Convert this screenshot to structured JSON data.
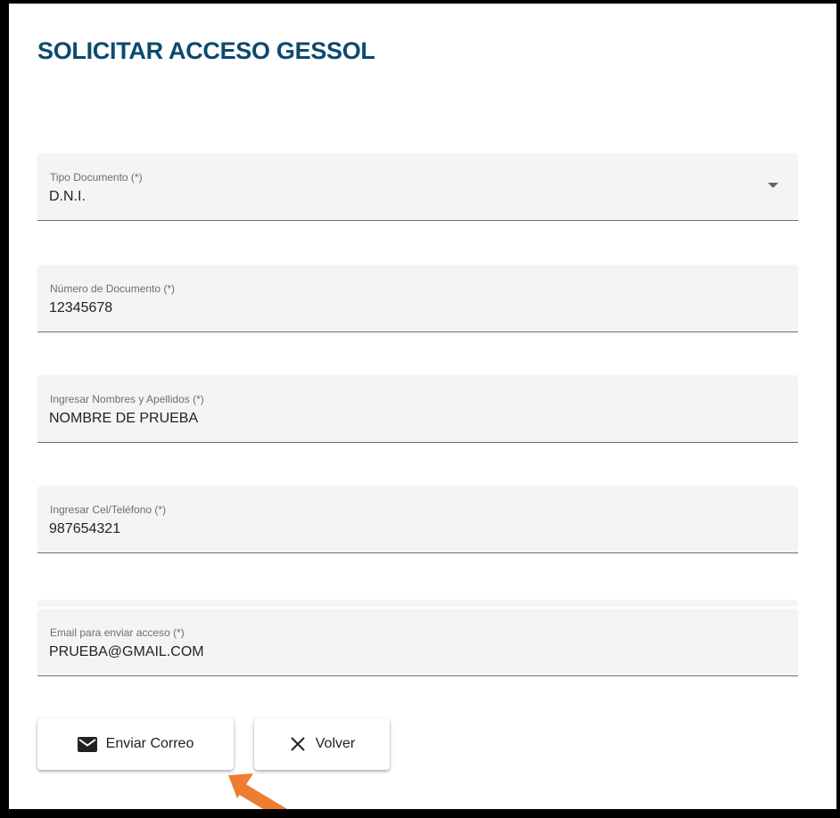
{
  "title": "SOLICITAR ACCESO GESSOL",
  "fields": [
    {
      "label": "Tipo Documento (*)",
      "value": "D.N.I."
    },
    {
      "label": "Número de Documento (*)",
      "value": "12345678"
    },
    {
      "label": "Ingresar Nombres y Apellidos (*)",
      "value": "NOMBRE DE PRUEBA"
    },
    {
      "label": "Ingresar Cel/Teléfono (*)",
      "value": "987654321"
    },
    {
      "label": "Email para enviar acceso (*)",
      "value": "PRUEBA@GMAIL.COM"
    }
  ],
  "buttons": {
    "send_label": "Enviar Correo",
    "send_icon": "mail-icon",
    "back_label": "Volver",
    "back_icon": "close-icon"
  },
  "colors": {
    "title": "#0b4a6f",
    "field_bg": "#f4f4f4",
    "annotation_arrow": "#ed7d31"
  }
}
